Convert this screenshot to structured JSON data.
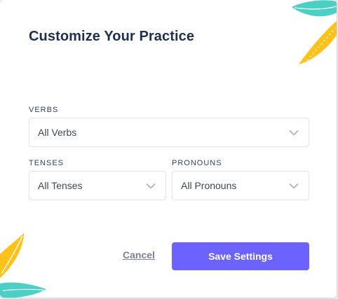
{
  "modal": {
    "title": "Customize Your Practice"
  },
  "verbs": {
    "label": "VERBS",
    "value": "All Verbs"
  },
  "tenses": {
    "label": "TENSES",
    "value": "All Tenses"
  },
  "pronouns": {
    "label": "PRONOUNS",
    "value": "All Pronouns"
  },
  "actions": {
    "cancel_label": "Cancel",
    "save_label": "Save Settings"
  },
  "icons": {
    "dropdown": "chevron-down-icon",
    "decoration": "leaf-icon"
  },
  "colors": {
    "primary": "#6c63ff",
    "title": "#1f2f4d",
    "leaf_teal": "#4ccfc4",
    "leaf_yellow": "#ffc21a"
  }
}
